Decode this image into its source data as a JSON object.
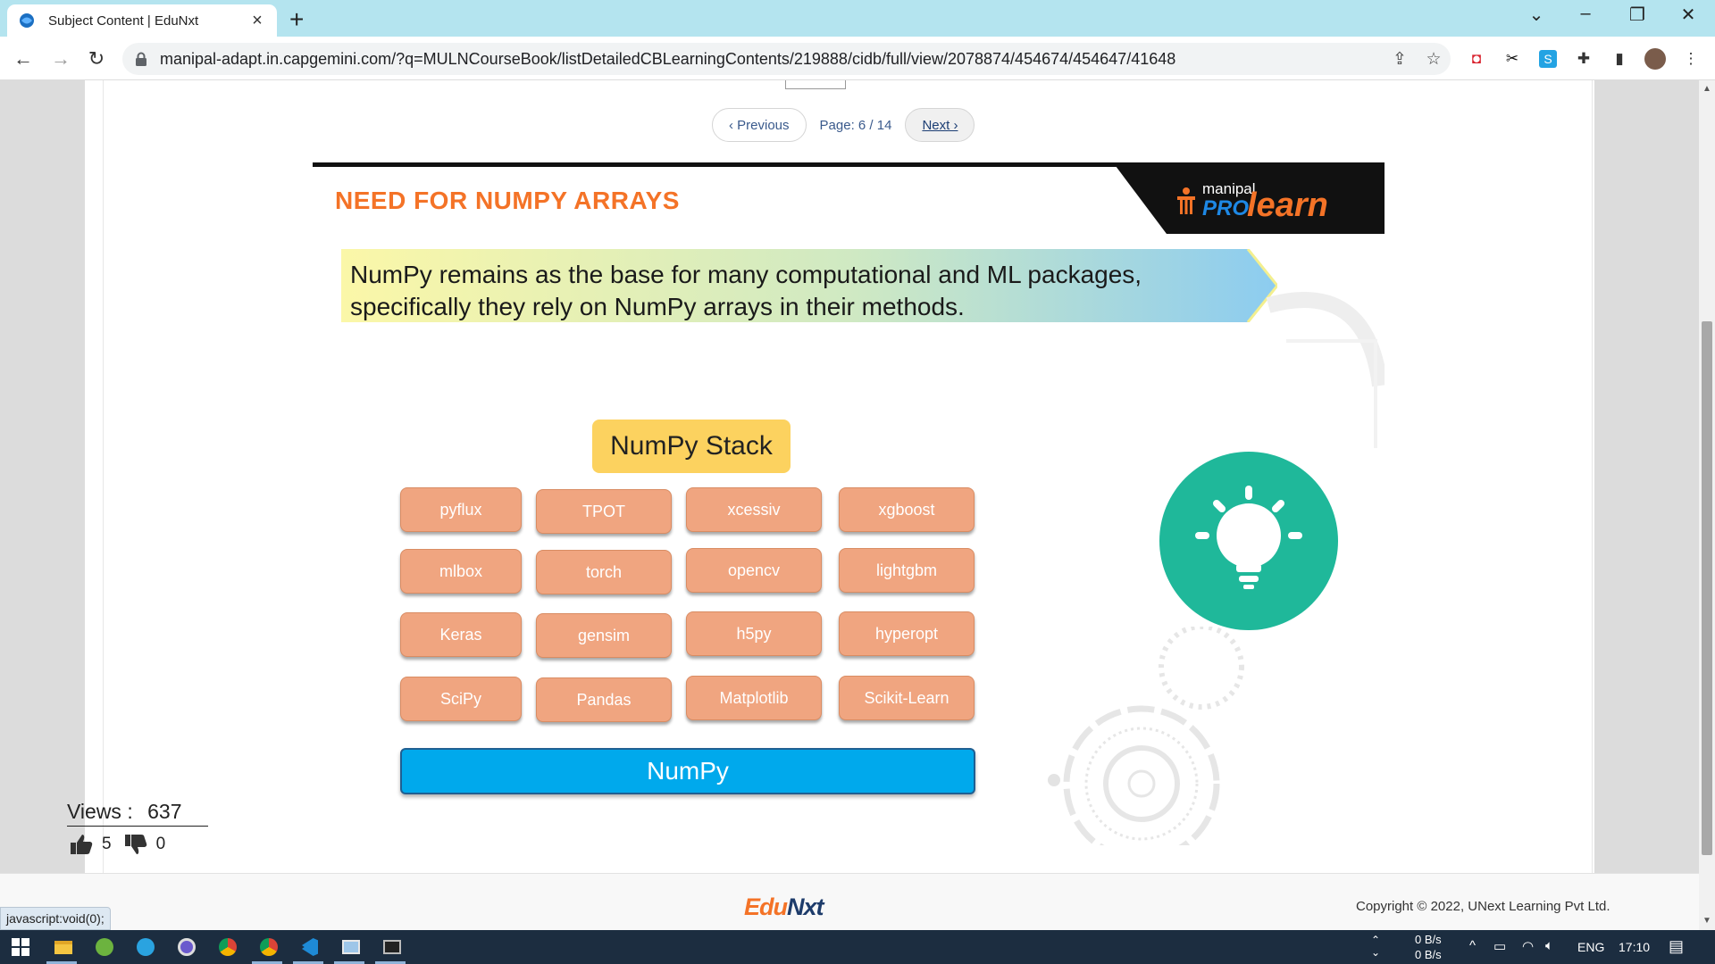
{
  "browser": {
    "tab_title": "Subject Content | EduNxt",
    "url": "manipal-adapt.in.capgemini.com/?q=MULNCourseBook/listDetailedCBLearningContents/219888/cidb/full/view/2078874/454674/454647/41648"
  },
  "pager": {
    "previous_label": "‹ Previous",
    "page_label": "Page: 6 / 14",
    "next_label": "Next ›"
  },
  "slide": {
    "title": "NEED FOR NUMPY ARRAYS",
    "brand_top": "manipal",
    "brand_pro": "PRO",
    "brand_learn": "learn",
    "banner_text": "NumPy remains as the base for many computational and ML packages, specifically they rely on NumPy arrays in their methods.",
    "stack_title": "NumPy Stack",
    "packages": [
      [
        "pyflux",
        "TPOT",
        "xcessiv",
        "xgboost"
      ],
      [
        "mlbox",
        "torch",
        "opencv",
        "lightgbm"
      ],
      [
        "Keras",
        "gensim",
        "h5py",
        "hyperopt"
      ],
      [
        "SciPy",
        "Pandas",
        "Matplotlib",
        "Scikit-Learn"
      ]
    ],
    "base_label": "NumPy"
  },
  "stats": {
    "views_label": "Views :",
    "views_count": "637",
    "likes": "5",
    "dislikes": "0"
  },
  "footer": {
    "logo_edu": "Edu",
    "logo_nxt": "Nxt",
    "copyright": "Copyright © 2022, UNext Learning Pvt Ltd.",
    "status_link": "javascript:void(0);"
  },
  "taskbar": {
    "net_up": "0 B/s",
    "net_down": "0 B/s",
    "lang": "ENG",
    "time": "17:10"
  },
  "colors": {
    "accent_orange": "#f47327",
    "package_fill": "#f0a580",
    "numpy_blue": "#00a9ec",
    "bulb_green": "#1fb89a",
    "stack_yellow": "#fcd25f"
  }
}
